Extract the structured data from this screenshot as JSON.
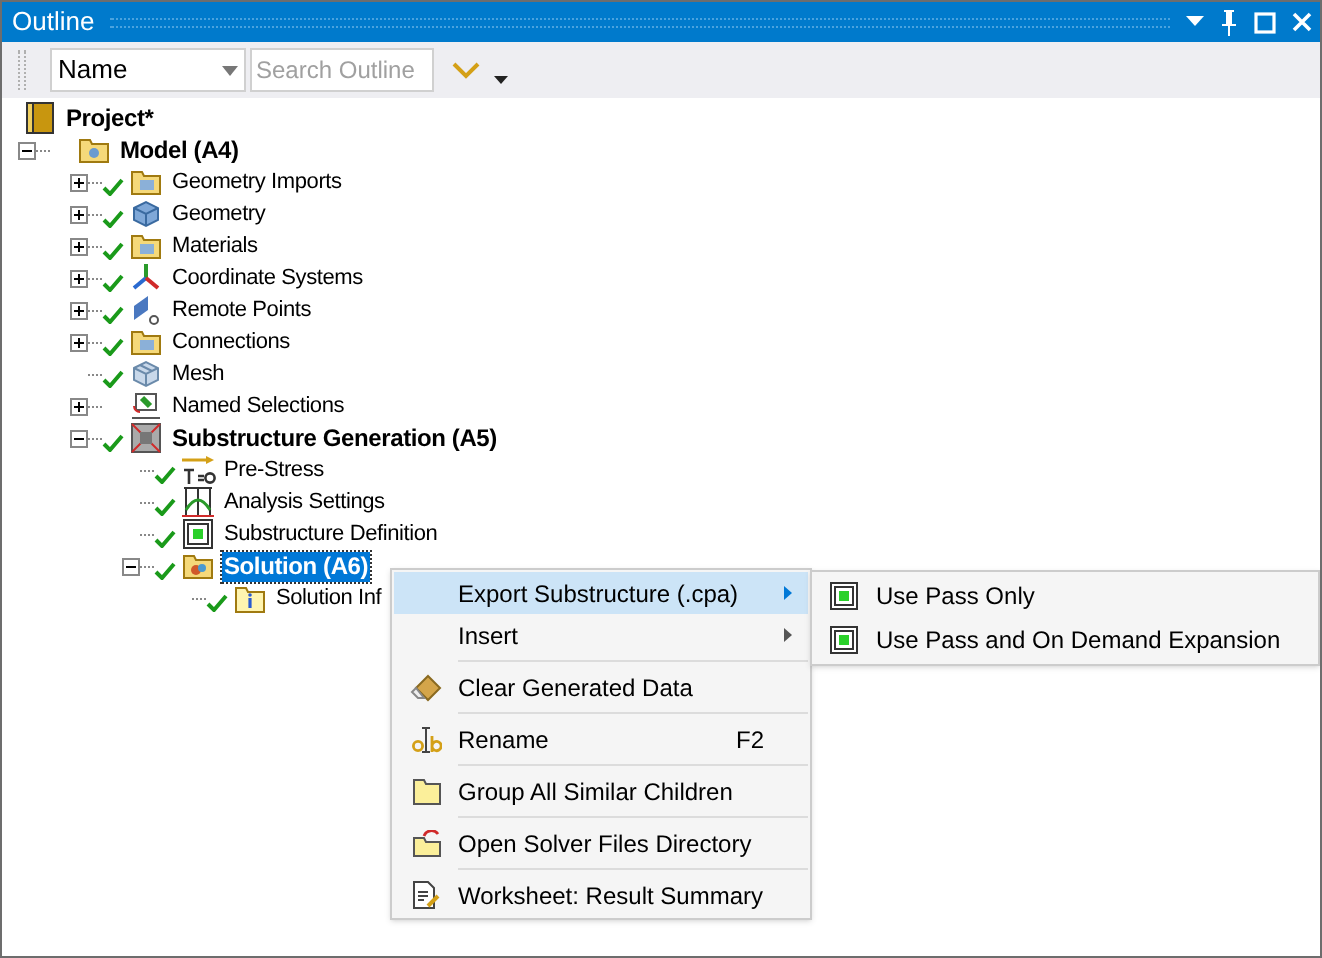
{
  "window": {
    "title": "Outline"
  },
  "toolbar": {
    "filter": {
      "value": "Name"
    },
    "search": {
      "placeholder": "Search Outline"
    }
  },
  "tree": {
    "label": "Project*",
    "kind": "project",
    "children": [
      {
        "label": "Model (A4)",
        "kind": "model",
        "bold": true,
        "expanded": true,
        "checked": false,
        "selected": false,
        "children": [
          {
            "label": "Geometry Imports",
            "kind": "folder",
            "expanded": false,
            "checked": true,
            "selected": false
          },
          {
            "label": "Geometry",
            "kind": "geometry",
            "expanded": false,
            "checked": true,
            "selected": false
          },
          {
            "label": "Materials",
            "kind": "folder",
            "expanded": false,
            "checked": true,
            "selected": false
          },
          {
            "label": "Coordinate Systems",
            "kind": "axes",
            "expanded": false,
            "checked": true,
            "selected": false
          },
          {
            "label": "Remote Points",
            "kind": "point",
            "expanded": false,
            "checked": true,
            "selected": false
          },
          {
            "label": "Connections",
            "kind": "folder",
            "expanded": false,
            "checked": true,
            "selected": false
          },
          {
            "label": "Mesh",
            "kind": "mesh",
            "checked": true,
            "selected": false
          },
          {
            "label": "Named Selections",
            "kind": "selection",
            "expanded": false,
            "checked": false,
            "selected": false
          },
          {
            "label": "Substructure Generation (A5)",
            "kind": "analysis",
            "bold": true,
            "expanded": true,
            "checked": true,
            "selected": false,
            "children": [
              {
                "label": "Pre-Stress",
                "kind": "prestress",
                "checked": true,
                "selected": false
              },
              {
                "label": "Analysis Settings",
                "kind": "settings",
                "checked": true,
                "selected": false
              },
              {
                "label": "Substructure Definition",
                "kind": "substructure",
                "checked": true,
                "selected": false
              },
              {
                "label": "Solution (A6)",
                "kind": "solution",
                "bold": true,
                "expanded": true,
                "checked": true,
                "selected": true,
                "children": [
                  {
                    "label": "Solution Inf",
                    "kind": "info",
                    "checked": true,
                    "selected": false
                  }
                ]
              }
            ]
          }
        ]
      }
    ]
  },
  "context_menu": {
    "items": [
      {
        "label": "Export Substructure (.cpa)",
        "kind": "submenu",
        "selected": true
      },
      {
        "label": "Insert",
        "kind": "submenu",
        "selected": false
      },
      {
        "label": "Clear Generated Data",
        "kind": "eraser",
        "selected": false
      },
      {
        "label": "Rename",
        "kind": "rename",
        "shortcut": "F2",
        "selected": false
      },
      {
        "label": "Group All Similar Children",
        "kind": "folder",
        "selected": false
      },
      {
        "label": "Open Solver Files Directory",
        "kind": "open-folder",
        "selected": false
      },
      {
        "label": "Worksheet: Result Summary",
        "kind": "worksheet",
        "selected": false
      }
    ]
  },
  "submenu": {
    "items": [
      {
        "label": "Use Pass Only"
      },
      {
        "label": "Use Pass and On Demand Expansion"
      }
    ]
  }
}
